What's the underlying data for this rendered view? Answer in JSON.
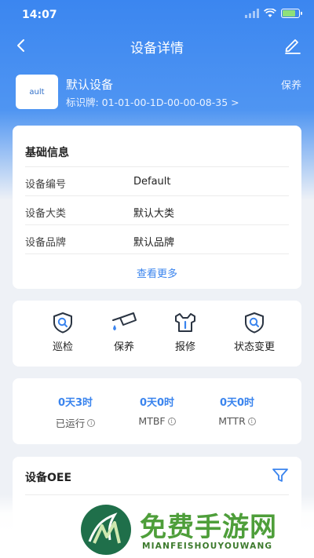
{
  "status_bar": {
    "time": "14:07"
  },
  "nav": {
    "title": "设备详情"
  },
  "device": {
    "logo_text": "ault",
    "name": "默认设备",
    "plate": "标识牌: 01-01-00-1D-00-00-08-35 >",
    "status": "保养"
  },
  "basic_info": {
    "title": "基础信息",
    "rows": [
      {
        "key": "设备编号",
        "value": "Default"
      },
      {
        "key": "设备大类",
        "value": "默认大类"
      },
      {
        "key": "设备品牌",
        "value": "默认品牌"
      }
    ],
    "more_label": "查看更多"
  },
  "actions": [
    {
      "label": "巡检",
      "icon": "shield-search-icon"
    },
    {
      "label": "保养",
      "icon": "oil-can-icon"
    },
    {
      "label": "报修",
      "icon": "wrench-icon"
    },
    {
      "label": "状态变更",
      "icon": "shield-search-icon"
    }
  ],
  "stats": [
    {
      "value": "0天3时",
      "label": "已运行"
    },
    {
      "value": "0天0时",
      "label": "MTBF"
    },
    {
      "value": "0天0时",
      "label": "MTTR"
    }
  ],
  "oee": {
    "title": "设备OEE"
  },
  "watermark": {
    "text": "免费手游网",
    "sub": "MIANFEISHOUYOUWANG"
  },
  "colors": {
    "primary": "#3a84ee",
    "header": "#3b86f0",
    "background": "#eef1f6"
  }
}
